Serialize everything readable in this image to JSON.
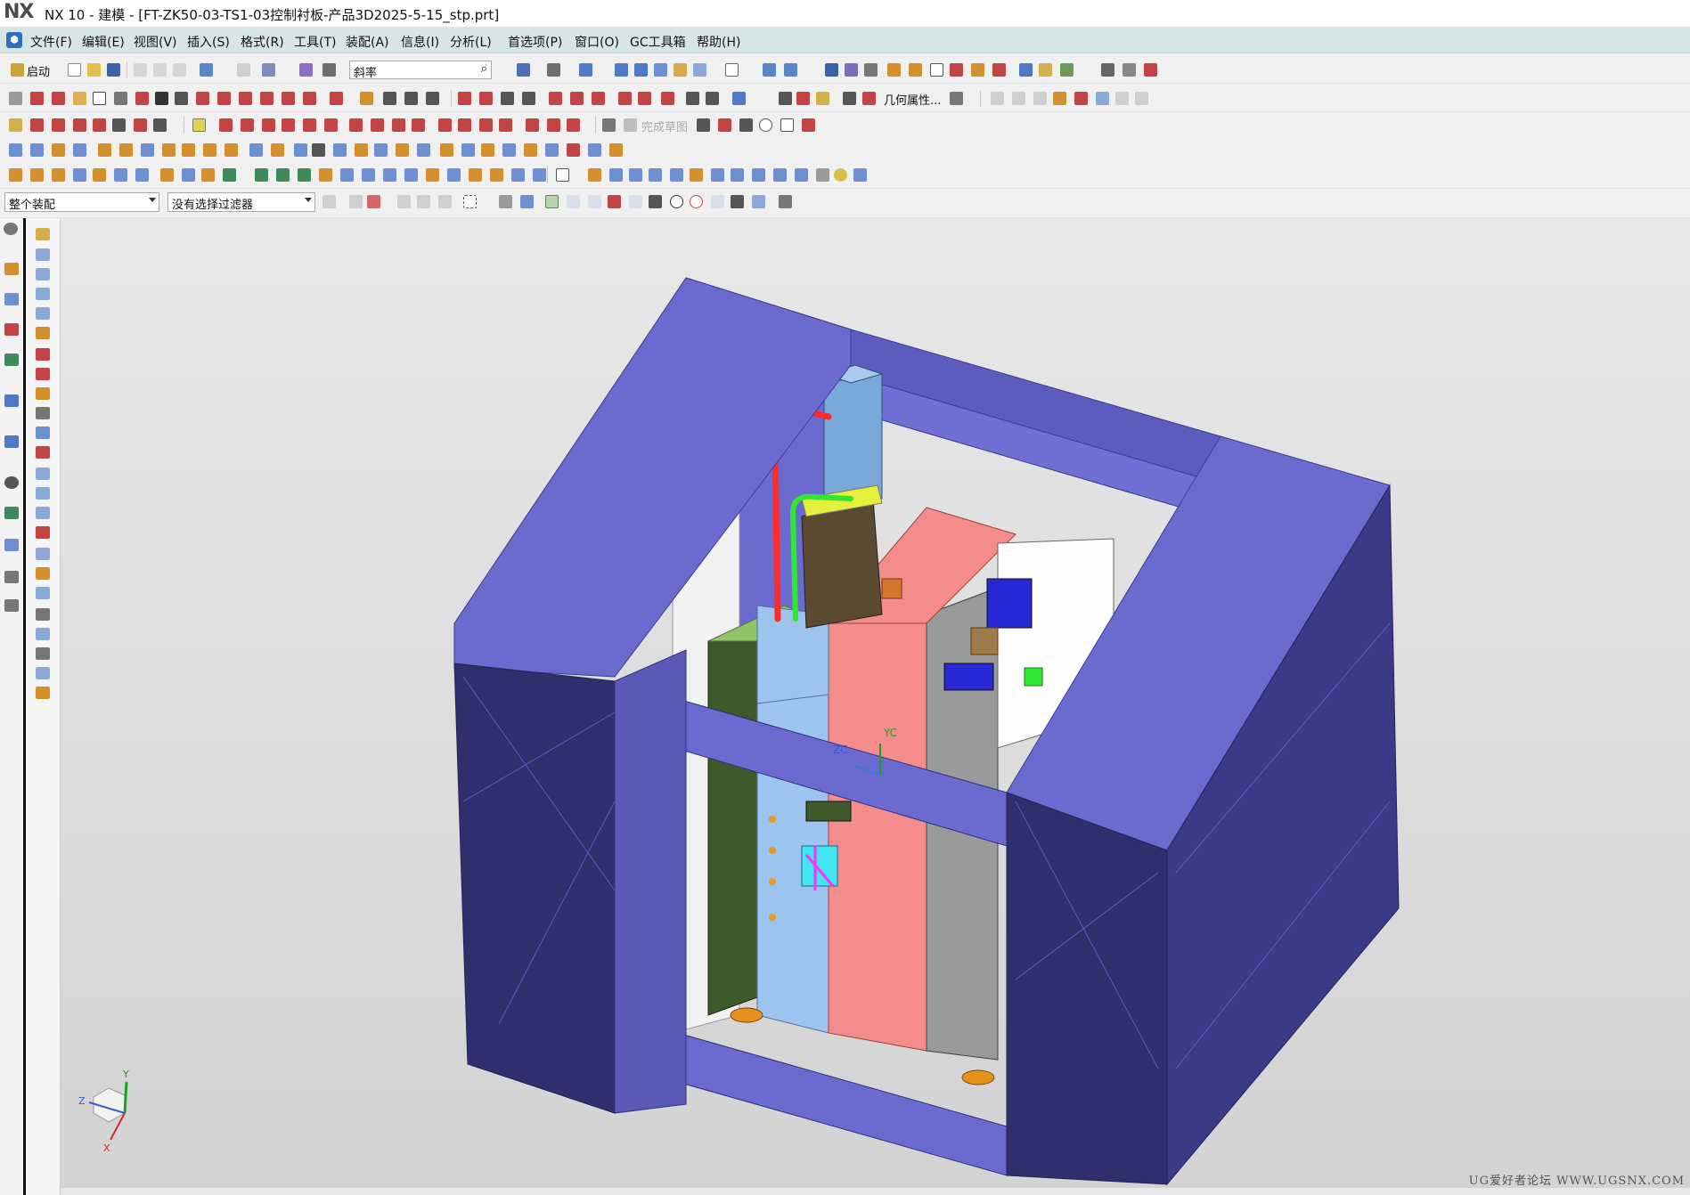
{
  "window": {
    "logo": "NX",
    "title": "NX 10 - 建模 - [FT-ZK50-03-TS1-03控制衬板-产品3D2025-5-15_stp.prt]"
  },
  "menus": [
    "文件(F)",
    "编辑(E)",
    "视图(V)",
    "插入(S)",
    "格式(R)",
    "工具(T)",
    "装配(A)",
    "信息(I)",
    "分析(L)",
    "首选项(P)",
    "窗口(O)",
    "GC工具箱",
    "帮助(H)"
  ],
  "toolbar": {
    "start_label": "启动",
    "search_value": "斜率",
    "geom_props_label": "几何属性...",
    "finish_sketch_label": "完成草图"
  },
  "selection": {
    "scope": "整个装配",
    "filter": "没有选择过滤器"
  },
  "viewport": {
    "axis_labels": [
      "ZC",
      "YC"
    ],
    "triad_labels": [
      "Y",
      "Z",
      "X"
    ],
    "watermark": "UG爱好者论坛 WWW.UGSNX.COM"
  },
  "colors": {
    "frame": "#6b6bcf",
    "frame_dark": "#2f2f6e",
    "accent_red": "#ff2a2a",
    "accent_green": "#33e633",
    "salmon": "#f58c8c",
    "light_blue": "#9dc4ef",
    "dark_green": "#3e5a2a"
  }
}
